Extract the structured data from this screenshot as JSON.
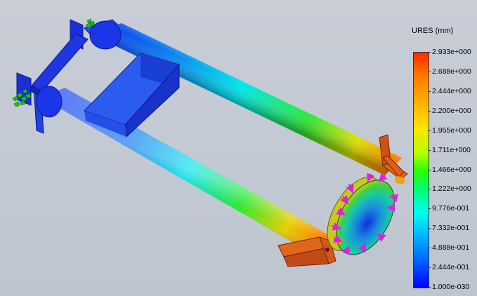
{
  "legend": {
    "title": "URES (mm)",
    "ticks": [
      "2.933e+000",
      "2.688e+000",
      "2.444e+000",
      "2.200e+000",
      "1.955e+000",
      "1.711e+000",
      "1.466e+000",
      "1.222e+000",
      "9.776e-001",
      "7.332e-001",
      "4.888e-001",
      "2.444e-001",
      "1.000e-030"
    ]
  },
  "colors": {
    "background": "#c8cdd6",
    "max": "#ff2a00",
    "min": "#0000ff",
    "load_arrows": "#e020e0",
    "fixtures": "#22bb22"
  },
  "icons": {
    "fixture_symbol": "fixed-geometry-icon",
    "load_symbol": "force-arrow-icon"
  }
}
